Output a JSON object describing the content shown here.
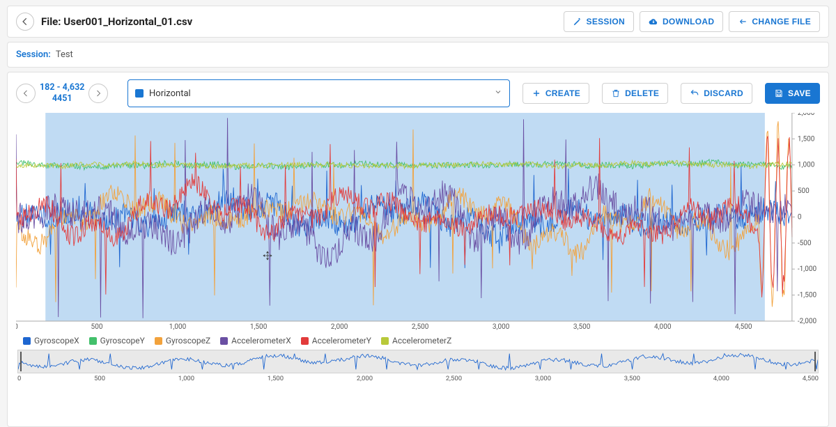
{
  "header": {
    "file_label_prefix": "File: ",
    "file_name": "User001_Horizontal_01.csv",
    "buttons": {
      "session": "Session",
      "download": "Download",
      "change_file": "Change File"
    }
  },
  "session": {
    "label": "Session:",
    "value": "Test"
  },
  "range": {
    "start": "182",
    "end": "4,632",
    "span": "4451"
  },
  "segment": {
    "selected_label": "Horizontal",
    "selected_color": "#1976d2"
  },
  "actions": {
    "create": "Create",
    "delete": "Delete",
    "discard": "Discard",
    "save": "Save"
  },
  "legend": [
    {
      "name": "GyroscopeX",
      "color": "#1e66d0"
    },
    {
      "name": "GyroscopeY",
      "color": "#43c06b"
    },
    {
      "name": "GyroscopeZ",
      "color": "#f2a23c"
    },
    {
      "name": "AccelerometerX",
      "color": "#6a4fa3"
    },
    {
      "name": "AccelerometerY",
      "color": "#e23b3b"
    },
    {
      "name": "AccelerometerZ",
      "color": "#b8c93a"
    }
  ],
  "colors": {
    "accent": "#1976d2",
    "selection": "rgba(115,176,229,0.45)"
  },
  "chart_data": {
    "type": "line",
    "title": "",
    "xlabel": "",
    "ylabel": "",
    "xlim": [
      0,
      4800
    ],
    "ylim": [
      -2000,
      2000
    ],
    "x_ticks": [
      "0",
      "500",
      "1,000",
      "1,500",
      "2,000",
      "2,500",
      "3,000",
      "3,500",
      "4,000",
      "4,500"
    ],
    "y_ticks": [
      "2,000",
      "1,500",
      "1,000",
      "500",
      "0",
      "-500",
      "-1,000",
      "-1,500",
      "-2,000"
    ],
    "selection": {
      "start": 182,
      "end": 4632
    },
    "series_summary": [
      {
        "name": "GyroscopeX",
        "baseline": 0,
        "amp_peak": 900,
        "noise": 250
      },
      {
        "name": "GyroscopeY",
        "baseline": 1000,
        "amp_peak": 120,
        "noise": 60
      },
      {
        "name": "GyroscopeZ",
        "baseline": 0,
        "amp_peak": 1600,
        "noise": 200,
        "burst_after": 4600
      },
      {
        "name": "AccelerometerX",
        "baseline": 0,
        "amp_peak": 1800,
        "noise": 300
      },
      {
        "name": "AccelerometerY",
        "baseline": 0,
        "amp_peak": 1400,
        "noise": 200,
        "burst_after": 4600
      },
      {
        "name": "AccelerometerZ",
        "baseline": 1000,
        "amp_peak": 100,
        "noise": 50
      }
    ],
    "overview_ticks": [
      "0",
      "500",
      "1,000",
      "1,500",
      "2,000",
      "2,500",
      "3,000",
      "3,500",
      "4,000",
      "4,500"
    ]
  }
}
